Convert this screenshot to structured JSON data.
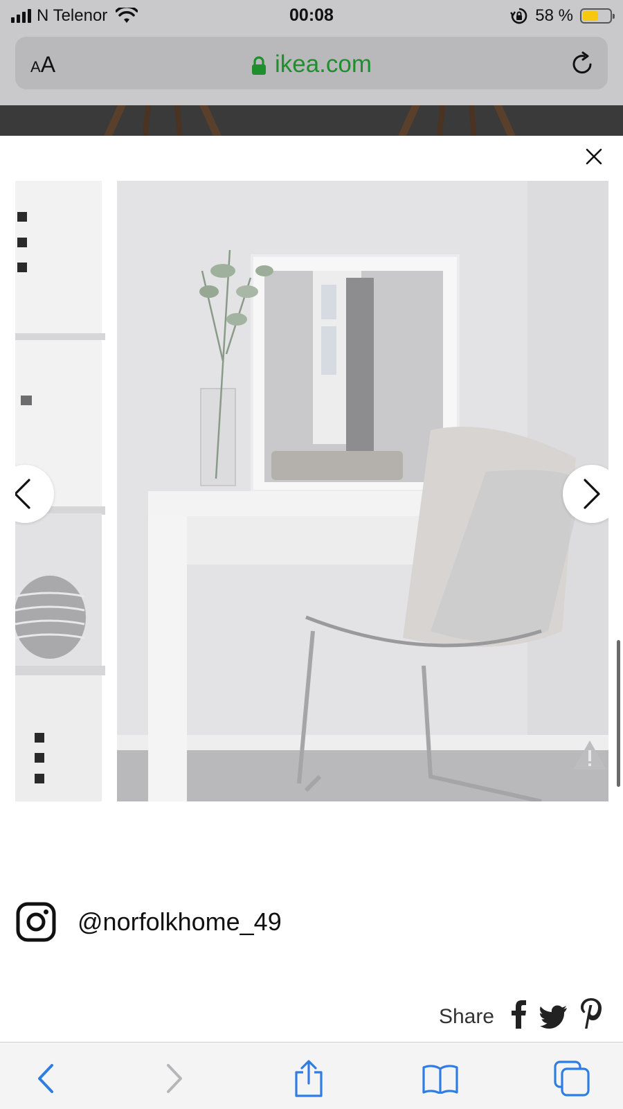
{
  "status_bar": {
    "carrier": "N Telenor",
    "time": "00:08",
    "battery_percent": "58 %",
    "battery_level": 0.58,
    "icons": [
      "signal-icon",
      "wifi-icon",
      "orientation-lock-icon",
      "battery-icon"
    ]
  },
  "browser": {
    "text_size_button": {
      "small": "A",
      "large": "A"
    },
    "domain": "ikea.com",
    "icons": [
      "lock-icon",
      "reload-icon"
    ]
  },
  "modal": {
    "close_icon": "close-icon",
    "photo_description_icons": [
      "chevron-left-icon",
      "chevron-right-icon",
      "warning-icon"
    ],
    "instagram_handle": "@norfolkhome_49",
    "share_label": "Share",
    "share_icons": [
      "facebook-icon",
      "twitter-icon",
      "pinterest-icon"
    ]
  },
  "toolbar": {
    "icons": [
      "back-icon",
      "forward-icon",
      "share-icon",
      "bookmarks-icon",
      "tabs-icon"
    ]
  },
  "colors": {
    "accent_blue": "#2f7de1",
    "secure_green": "#1f8f2d",
    "battery_yellow": "#f6c90e"
  }
}
